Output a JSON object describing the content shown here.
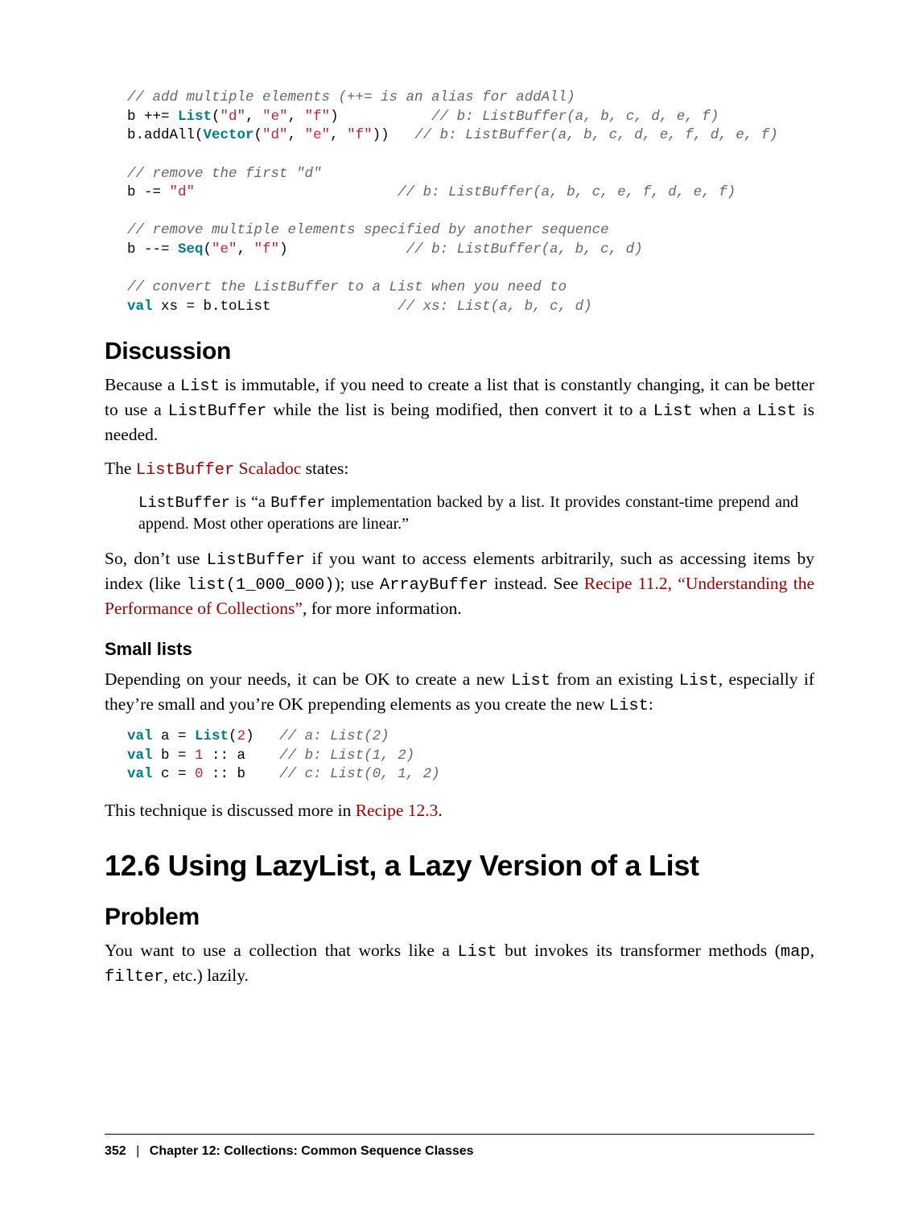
{
  "code_block_1_html": "<span class=\"tok-comment\">// add multiple elements (++= is an alias for addAll)</span>\nb ++= <span class=\"tok-type\">List</span>(<span class=\"tok-string\">\"d\"</span>, <span class=\"tok-string\">\"e\"</span>, <span class=\"tok-string\">\"f\"</span>)           <span class=\"tok-comment\">// b: ListBuffer(a, b, c, d, e, f)</span>\nb.addAll(<span class=\"tok-type\">Vector</span>(<span class=\"tok-string\">\"d\"</span>, <span class=\"tok-string\">\"e\"</span>, <span class=\"tok-string\">\"f\"</span>))   <span class=\"tok-comment\">// b: ListBuffer(a, b, c, d, e, f, d, e, f)</span>\n\n<span class=\"tok-comment\">// remove the first \"d\"</span>\nb -= <span class=\"tok-string\">\"d\"</span>                        <span class=\"tok-comment\">// b: ListBuffer(a, b, c, e, f, d, e, f)</span>\n\n<span class=\"tok-comment\">// remove multiple elements specified by another sequence</span>\nb --= <span class=\"tok-type\">Seq</span>(<span class=\"tok-string\">\"e\"</span>, <span class=\"tok-string\">\"f\"</span>)              <span class=\"tok-comment\">// b: ListBuffer(a, b, c, d)</span>\n\n<span class=\"tok-comment\">// convert the ListBuffer to a List when you need to</span>\n<span class=\"tok-keyword\">val</span> xs = b.toList               <span class=\"tok-comment\">// xs: List(a, b, c, d)</span>",
  "heading_discussion": "Discussion",
  "p_d1_a": "Because a ",
  "p_d1_code1": "List",
  "p_d1_b": " is immutable, if you need to create a list that is constantly changing, it can be better to use a ",
  "p_d1_code2": "ListBuffer",
  "p_d1_c": " while the list is being modified, then convert it to a ",
  "p_d1_code3": "List",
  "p_d1_d": " when a ",
  "p_d1_code4": "List",
  "p_d1_e": " is needed.",
  "p_d2_a": "The ",
  "link_scaladoc": "ListBuffer Scaladoc",
  "p_d2_b": " states:",
  "bq_a": "",
  "bq_code1": "ListBuffer",
  "bq_b": " is “a ",
  "bq_code2": "Buffer",
  "bq_c": " implementation backed by a list. It provides constant-time prepend and append. Most other operations are linear.”",
  "p_d3_a": "So, don’t use ",
  "p_d3_code1": "ListBuffer",
  "p_d3_b": " if you want to access elements arbitrarily, such as accessing items by index (like ",
  "p_d3_code2": "list(1_000_000)",
  "p_d3_c": "); use ",
  "p_d3_code3": "ArrayBuffer",
  "p_d3_d": " instead. See ",
  "link_recipe112": "Recipe 11.2, “Understanding the Performance of Collections”",
  "p_d3_e": ", for more information.",
  "heading_small_lists": "Small lists",
  "p_sl_a": "Depending on your needs, it can be OK to create a new ",
  "p_sl_code1": "List",
  "p_sl_b": " from an existing ",
  "p_sl_code2": "List",
  "p_sl_c": ", especially if they’re small and you’re OK prepending elements as you create the new ",
  "p_sl_code3": "List",
  "p_sl_d": ":",
  "code_block_2_html": "<span class=\"tok-keyword\">val</span> a = <span class=\"tok-type\">List</span>(<span class=\"tok-number\">2</span>)   <span class=\"tok-comment\">// a: List(2)</span>\n<span class=\"tok-keyword\">val</span> b = <span class=\"tok-number\">1</span> :: a    <span class=\"tok-comment\">// b: List(1, 2)</span>\n<span class=\"tok-keyword\">val</span> c = <span class=\"tok-number\">0</span> :: b    <span class=\"tok-comment\">// c: List(0, 1, 2)</span>",
  "p_sl2_a": "This technique is discussed more in ",
  "link_recipe123": "Recipe 12.3",
  "p_sl2_b": ".",
  "heading_recipe": "12.6 Using LazyList, a Lazy Version of a List",
  "heading_problem": "Problem",
  "p_pr_a": "You want to use a collection that works like a ",
  "p_pr_code1": "List",
  "p_pr_b": " but invokes its transformer methods (",
  "p_pr_code2": "map",
  "p_pr_c": ", ",
  "p_pr_code3": "filter",
  "p_pr_d": ", etc.) lazily.",
  "footer_page": "352",
  "footer_sep": "|",
  "footer_chapter": "Chapter 12: Collections: Common Sequence Classes"
}
